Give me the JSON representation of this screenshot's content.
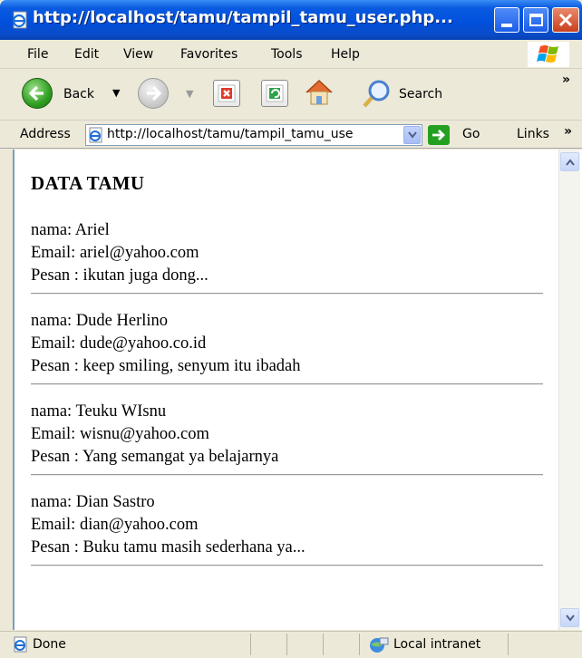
{
  "window": {
    "title": "http://localhost/tamu/tampil_tamu_user.php...",
    "colors": {
      "titlebar": "#0050dd",
      "close_button": "#c8401f",
      "content_bg": "#ffffff"
    }
  },
  "menu": {
    "items": [
      "File",
      "Edit",
      "View",
      "Favorites",
      "Tools",
      "Help"
    ]
  },
  "toolbar": {
    "back_label": "Back",
    "search_label": "Search",
    "icons": [
      "back-icon",
      "forward-icon",
      "stop-icon",
      "refresh-icon",
      "home-icon",
      "search-icon"
    ]
  },
  "address": {
    "label": "Address",
    "url": "http://localhost/tamu/tampil_tamu_use",
    "go_label": "Go",
    "links_label": "Links"
  },
  "page": {
    "heading": "DATA TAMU",
    "entries": [
      {
        "nama": "nama: Ariel",
        "email": "Email: ariel@yahoo.com",
        "pesan": "Pesan : ikutan juga dong..."
      },
      {
        "nama": "nama: Dude Herlino",
        "email": "Email: dude@yahoo.co.id",
        "pesan": "Pesan : keep smiling, senyum itu ibadah"
      },
      {
        "nama": "nama: Teuku WIsnu",
        "email": "Email: wisnu@yahoo.com",
        "pesan": "Pesan : Yang semangat ya belajarnya"
      },
      {
        "nama": "nama: Dian Sastro",
        "email": "Email: dian@yahoo.com",
        "pesan": "Pesan : Buku tamu masih sederhana ya..."
      }
    ]
  },
  "status": {
    "text": "Done",
    "zone": "Local intranet"
  }
}
